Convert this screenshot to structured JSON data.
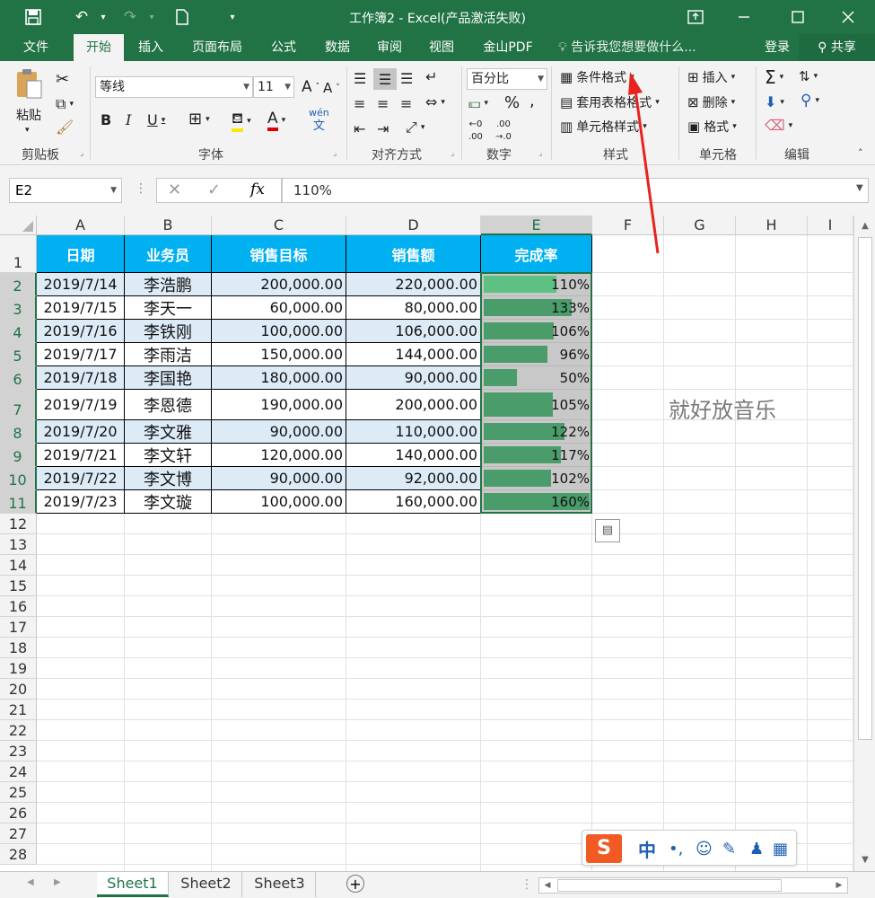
{
  "window": {
    "title": "工作簿2 - Excel(产品激活失败)",
    "icons": {
      "save": "save-icon",
      "undo": "undo-icon",
      "redo": "redo-icon",
      "new": "new-file-icon",
      "customize": "customize-icon",
      "ribbon_display": "ribbon-display-icon",
      "minimize": "minimize-icon",
      "maximize": "maximize-icon",
      "close": "close-icon"
    }
  },
  "menu": {
    "tabs": [
      "文件",
      "开始",
      "插入",
      "页面布局",
      "公式",
      "数据",
      "审阅",
      "视图",
      "金山PDF"
    ],
    "active": "开始",
    "tell_me": "告诉我您想要做什么...",
    "login": "登录",
    "share": "共享"
  },
  "ribbon": {
    "clipboard": {
      "label": "剪贴板",
      "paste": "粘贴"
    },
    "font": {
      "label": "字体",
      "name": "等线",
      "size": "11"
    },
    "alignment": {
      "label": "对齐方式"
    },
    "number": {
      "label": "数字",
      "format": "百分比"
    },
    "styles": {
      "label": "样式",
      "conditional": "条件格式",
      "table": "套用表格格式",
      "cell": "单元格样式"
    },
    "cells": {
      "label": "单元格",
      "insert": "插入",
      "delete": "删除",
      "format": "格式"
    },
    "editing": {
      "label": "编辑"
    }
  },
  "formula_bar": {
    "name_box": "E2",
    "value": "110%"
  },
  "columns": [
    "A",
    "B",
    "C",
    "D",
    "E",
    "F",
    "G",
    "H",
    "I"
  ],
  "rows": [
    "1",
    "2",
    "3",
    "4",
    "5",
    "6",
    "7",
    "8",
    "9",
    "10",
    "11",
    "12",
    "13",
    "14",
    "15",
    "16",
    "17",
    "18",
    "19",
    "20",
    "21",
    "22",
    "23",
    "24",
    "25",
    "26",
    "27",
    "28"
  ],
  "table": {
    "headers": [
      "日期",
      "业务员",
      "销售目标",
      "销售额",
      "完成率"
    ],
    "records": [
      {
        "date": "2019/7/14",
        "name": "李浩鹏",
        "target": "200,000.00",
        "sales": "220,000.00",
        "rate": "110%",
        "rate_value": 1.1
      },
      {
        "date": "2019/7/15",
        "name": "李天一",
        "target": "60,000.00",
        "sales": "80,000.00",
        "rate": "133%",
        "rate_value": 1.33
      },
      {
        "date": "2019/7/16",
        "name": "李铁刚",
        "target": "100,000.00",
        "sales": "106,000.00",
        "rate": "106%",
        "rate_value": 1.06
      },
      {
        "date": "2019/7/17",
        "name": "李雨洁",
        "target": "150,000.00",
        "sales": "144,000.00",
        "rate": "96%",
        "rate_value": 0.96
      },
      {
        "date": "2019/7/18",
        "name": "李国艳",
        "target": "180,000.00",
        "sales": "90,000.00",
        "rate": "50%",
        "rate_value": 0.5
      },
      {
        "date": "2019/7/19",
        "name": "李恩德",
        "target": "190,000.00",
        "sales": "200,000.00",
        "rate": "105%",
        "rate_value": 1.05
      },
      {
        "date": "2019/7/20",
        "name": "李文雅",
        "target": "90,000.00",
        "sales": "110,000.00",
        "rate": "122%",
        "rate_value": 1.22
      },
      {
        "date": "2019/7/21",
        "name": "李文轩",
        "target": "120,000.00",
        "sales": "140,000.00",
        "rate": "117%",
        "rate_value": 1.17
      },
      {
        "date": "2019/7/22",
        "name": "李文博",
        "target": "90,000.00",
        "sales": "92,000.00",
        "rate": "102%",
        "rate_value": 1.02
      },
      {
        "date": "2019/7/23",
        "name": "李文璇",
        "target": "100,000.00",
        "sales": "160,000.00",
        "rate": "160%",
        "rate_value": 1.6
      }
    ]
  },
  "databar_max": 1.6,
  "annotation_text": "就好放音乐",
  "sheets": [
    "Sheet1",
    "Sheet2",
    "Sheet3"
  ],
  "active_sheet": "Sheet1",
  "ime": {
    "logo": "S",
    "mode": "中"
  },
  "colors": {
    "excel_green": "#217346",
    "header_fill": "#00b0f0",
    "band_fill": "#ddebf7",
    "databar": "#4a9c6b",
    "arrow": "#e8231f"
  }
}
